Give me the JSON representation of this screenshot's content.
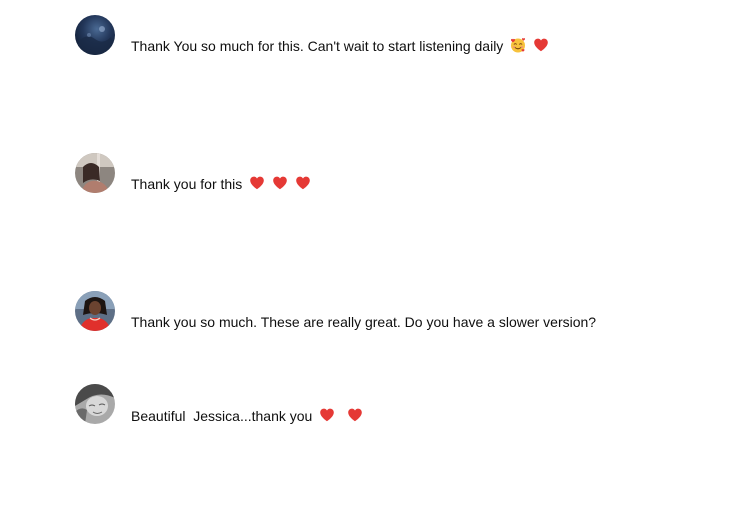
{
  "comments": [
    {
      "text": "Thank You so much for this. Can't wait to start listening daily",
      "emojis": [
        "smiling-face-with-hearts-icon",
        "red-heart-icon"
      ]
    },
    {
      "text": "Thank you for this",
      "emojis": [
        "red-heart-icon",
        "red-heart-icon",
        "red-heart-icon"
      ]
    },
    {
      "text": "Thank you so much. These are really great. Do you have a slower version?",
      "emojis": []
    },
    {
      "text": "Beautiful  Jessica...thank you",
      "emojis": [
        "red-heart-icon",
        "red-heart-icon"
      ]
    }
  ],
  "colors": {
    "heart": "#e53935",
    "text": "#0f0f0f",
    "background": "#ffffff"
  }
}
